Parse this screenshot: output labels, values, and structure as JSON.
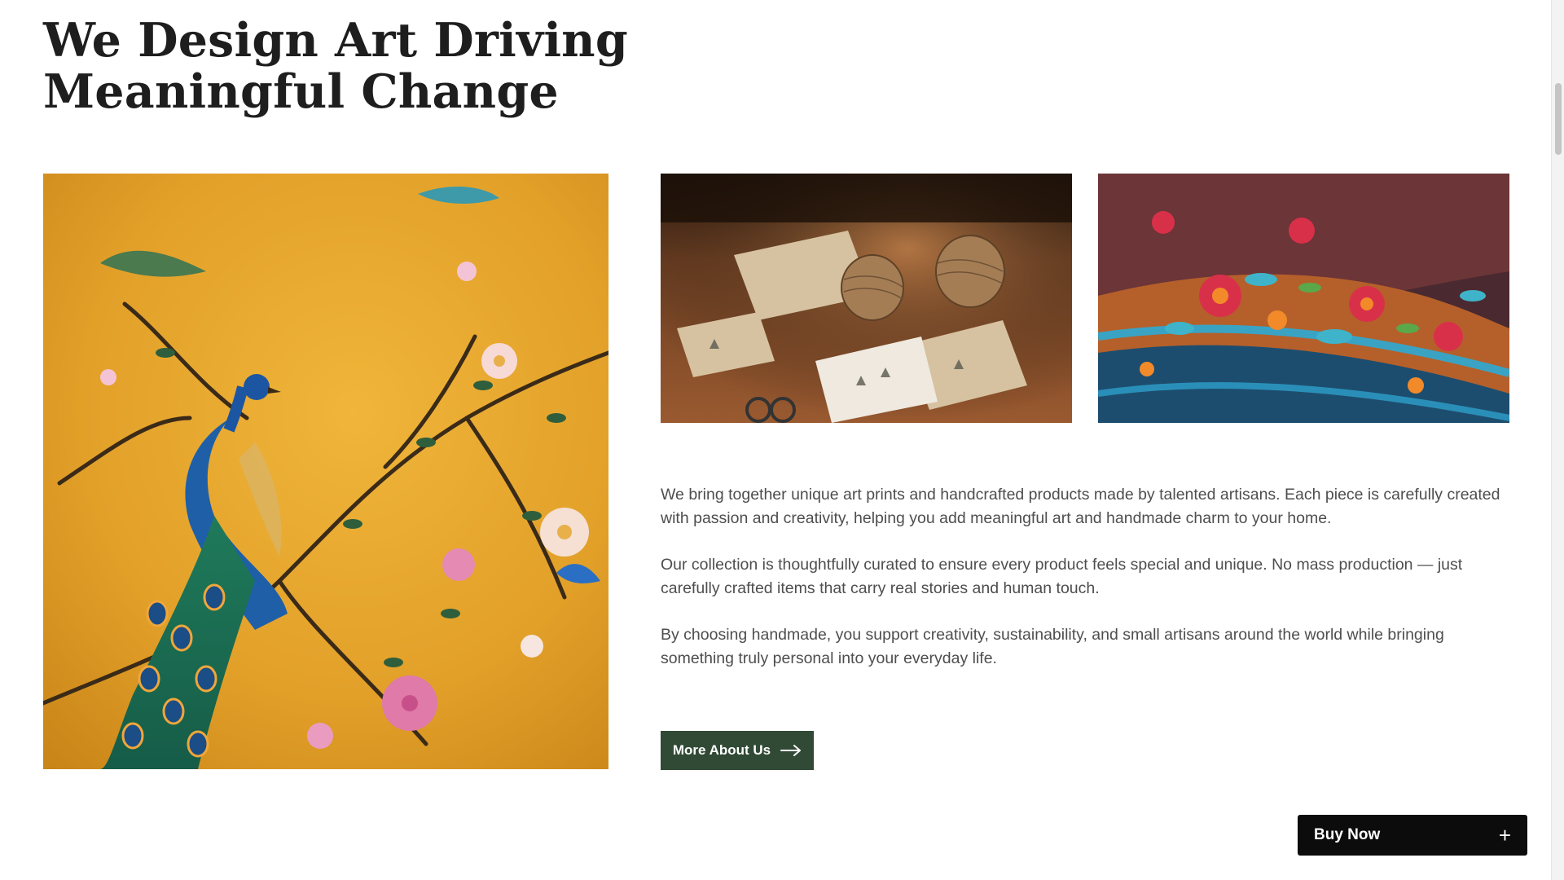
{
  "heading": {
    "line1": "We Design Art Driving",
    "line2": "Meaningful Change"
  },
  "images": {
    "painting": "peacock-floral-painting",
    "crafts": "craft-stationery-twine-photo",
    "embroidery": "embroidery-fabric-closeup-photo"
  },
  "about": {
    "paragraph1": "We bring together unique art prints and handcrafted products made by talented artisans. Each piece is carefully created with passion and creativity, helping you add meaningful art and handmade charm to your home.",
    "paragraph2": "Our collection is thoughtfully curated to ensure every product feels special and unique. No mass production — just carefully crafted items that carry real stories and human touch.",
    "paragraph3": "By choosing handmade, you support creativity, sustainability, and small artisans around the world while bringing something truly personal into your everyday life."
  },
  "buttons": {
    "more_about": "More About Us",
    "buy_now": "Buy Now"
  },
  "colors": {
    "primary_button": "#314a36",
    "buy_button": "#0c0c0c",
    "painting_background": "#e0a02a"
  },
  "icons": [
    "arrow-right-icon",
    "plus-icon"
  ]
}
